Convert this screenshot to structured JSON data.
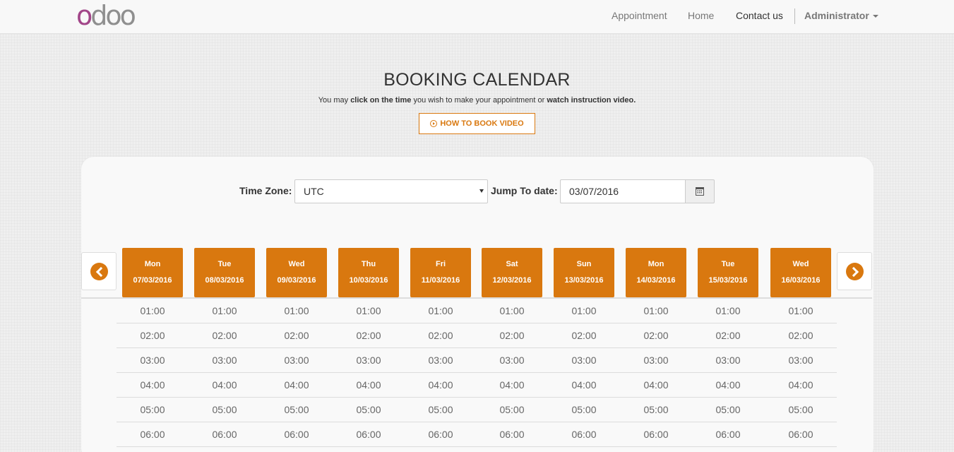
{
  "navbar": {
    "logo_first": "o",
    "logo_rest": "doo",
    "links": [
      {
        "label": "Appointment",
        "active": false
      },
      {
        "label": "Home",
        "active": false
      },
      {
        "label": "Contact us",
        "active": true
      }
    ],
    "user": "Administrator"
  },
  "header": {
    "title": "BOOKING CALENDAR",
    "subtitle_1": "You may ",
    "subtitle_bold_1": "click on the time",
    "subtitle_2": " you wish to make your appointment or ",
    "subtitle_bold_2": "watch instruction video.",
    "video_button": "HOW TO BOOK VIDEO"
  },
  "filters": {
    "timezone_label": "Time Zone:",
    "timezone_value": "UTC",
    "jump_label": "Jump To date:",
    "jump_value": "03/07/2016"
  },
  "days": [
    {
      "name": "Mon",
      "date": "07/03/2016"
    },
    {
      "name": "Tue",
      "date": "08/03/2016"
    },
    {
      "name": "Wed",
      "date": "09/03/2016"
    },
    {
      "name": "Thu",
      "date": "10/03/2016"
    },
    {
      "name": "Fri",
      "date": "11/03/2016"
    },
    {
      "name": "Sat",
      "date": "12/03/2016"
    },
    {
      "name": "Sun",
      "date": "13/03/2016"
    },
    {
      "name": "Mon",
      "date": "14/03/2016"
    },
    {
      "name": "Tue",
      "date": "15/03/2016"
    },
    {
      "name": "Wed",
      "date": "16/03/2016"
    }
  ],
  "times": [
    "01:00",
    "02:00",
    "03:00",
    "04:00",
    "05:00",
    "06:00"
  ],
  "colors": {
    "accent": "#d9780f",
    "logo_purple": "#a24689",
    "logo_gray": "#8f8f8f"
  },
  "icons": {
    "prev": "chevron-left-circle-icon",
    "next": "chevron-right-circle-icon",
    "calendar": "calendar-icon",
    "play": "play-circle-icon",
    "dropdown": "caret-down-icon"
  }
}
